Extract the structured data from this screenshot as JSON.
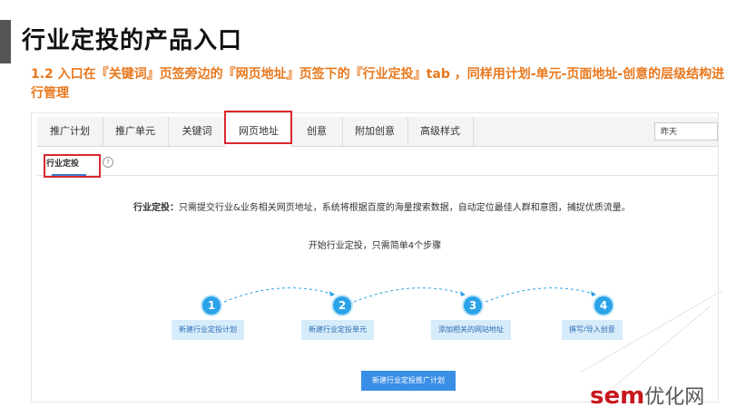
{
  "slide": {
    "title": "行业定投的产品入口",
    "subtitle": "1.2  入口在『关键词』页签旁边的『网页地址』页签下的『行业定投』tab  ，同样用计划-单元-页面地址-创意的层级结构进行管理"
  },
  "tabs": [
    {
      "label": "推广计划"
    },
    {
      "label": "推广单元"
    },
    {
      "label": "关键词"
    },
    {
      "label": "网页地址"
    },
    {
      "label": "创意"
    },
    {
      "label": "附加创意"
    },
    {
      "label": "高级样式"
    }
  ],
  "date_filter": {
    "value": "昨天"
  },
  "subtab": {
    "label": "行业定投",
    "help": "?"
  },
  "description": {
    "label": "行业定投：",
    "text": "只需提交行业&业务相关网页地址，系统将根据百度的海量搜索数据，自动定位最佳人群和意图，捕捉优质流量。"
  },
  "steps_heading": "开始行业定投，只需简单4个步骤",
  "steps": [
    {
      "number": "1",
      "label": "新建行业定投计划"
    },
    {
      "number": "2",
      "label": "新建行业定投单元"
    },
    {
      "number": "3",
      "label": "添加相关的网站地址"
    },
    {
      "number": "4",
      "label": "撰写/导入创意"
    }
  ],
  "cta": {
    "label": "新建行业定投推广计划"
  },
  "watermark": {
    "brand": "sem",
    "suffix": "优化网"
  },
  "colors": {
    "accent_orange": "#e8781e",
    "highlight_red": "#d9272e",
    "step_blue": "#2aa3e8",
    "brand_red": "#c8161d"
  }
}
